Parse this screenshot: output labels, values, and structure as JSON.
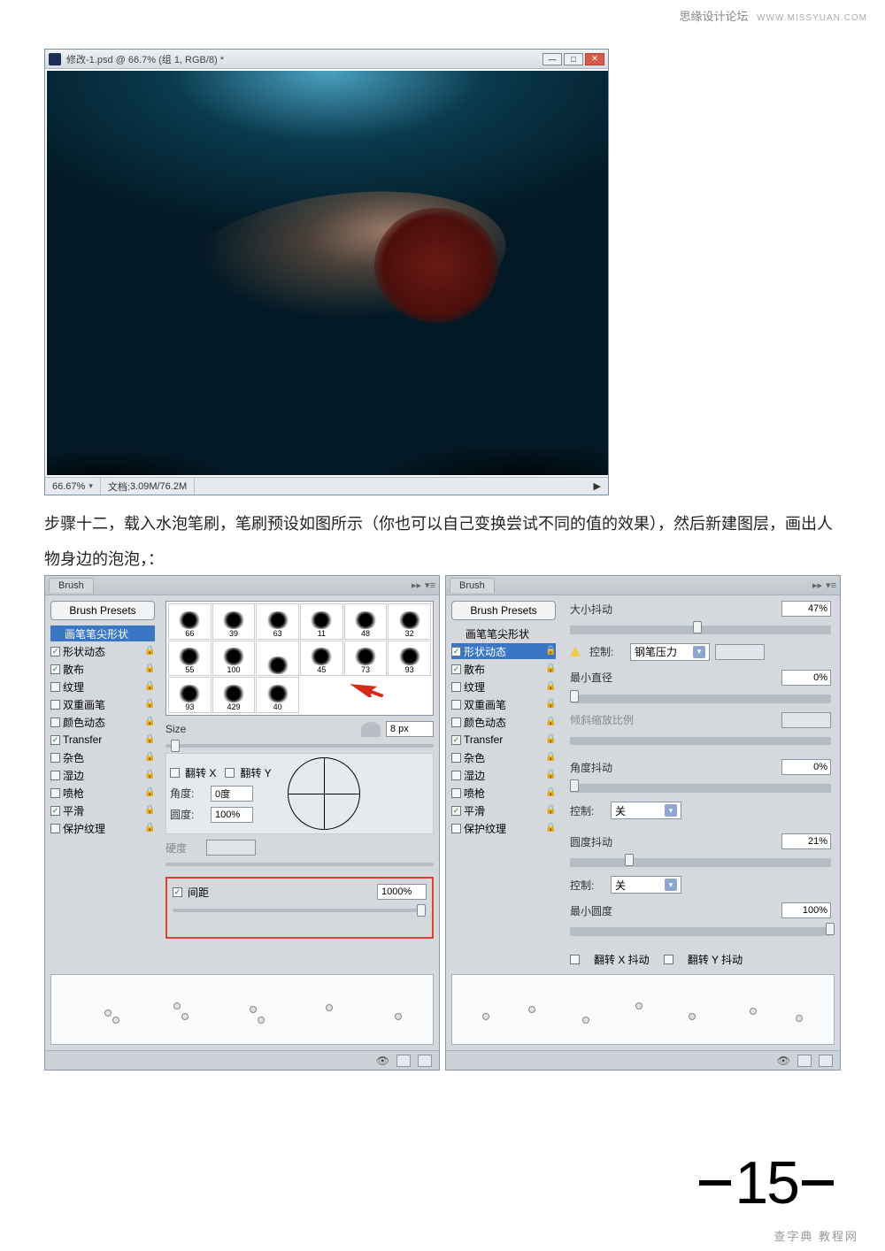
{
  "watermark": {
    "top_text": "思缘设计论坛",
    "top_url": "WWW.MISSYUAN.COM",
    "bottom_text": "查字典 教程网"
  },
  "page_number": "15",
  "ps_window": {
    "title": "修改-1.psd @ 66.7% (组 1, RGB/8) *",
    "zoom": "66.67%",
    "doc_label": "文档:",
    "doc_stat": "3.09M/76.2M"
  },
  "body_text": "步骤十二，载入水泡笔刷，笔刷预设如图所示（你也可以自己变换尝试不同的值的效果），然后新建图层，画出人物身边的泡泡，：",
  "brush_common": {
    "tab": "Brush",
    "presets_btn": "Brush Presets",
    "sidebar_items": [
      {
        "label": "画笔笔尖形状",
        "checked": null,
        "lock": false,
        "selected": true
      },
      {
        "label": "形状动态",
        "checked": true,
        "lock": true,
        "selected": false
      },
      {
        "label": "散布",
        "checked": true,
        "lock": true,
        "selected": false
      },
      {
        "label": "纹理",
        "checked": false,
        "lock": true,
        "selected": false
      },
      {
        "label": "双重画笔",
        "checked": false,
        "lock": true,
        "selected": false
      },
      {
        "label": "颜色动态",
        "checked": false,
        "lock": true,
        "selected": false
      },
      {
        "label": "Transfer",
        "checked": true,
        "lock": true,
        "selected": false
      },
      {
        "label": "杂色",
        "checked": false,
        "lock": true,
        "selected": false
      },
      {
        "label": "湿边",
        "checked": false,
        "lock": true,
        "selected": false
      },
      {
        "label": "喷枪",
        "checked": false,
        "lock": true,
        "selected": false
      },
      {
        "label": "平滑",
        "checked": true,
        "lock": true,
        "selected": false
      },
      {
        "label": "保护纹理",
        "checked": false,
        "lock": true,
        "selected": false
      }
    ]
  },
  "brush_left": {
    "sidebar_selected_override": "画笔笔尖形状",
    "thumbs": [
      "66",
      "39",
      "63",
      "11",
      "48",
      "32",
      "55",
      "100",
      "",
      "45",
      "73",
      "93",
      "93",
      "429",
      "40"
    ],
    "size_label": "Size",
    "size_value": "8 px",
    "flip_x": "翻转 X",
    "flip_y": "翻转 Y",
    "angle_label": "角度:",
    "angle_value": "0度",
    "roundness_label": "圆度:",
    "roundness_value": "100%",
    "hardness_label": "硬度",
    "spacing_label": "间距",
    "spacing_value": "1000%"
  },
  "brush_right": {
    "sidebar_selected_override": "形状动态",
    "size_jitter_label": "大小抖动",
    "size_jitter_value": "47%",
    "control_label": "控制:",
    "control_pen": "钢笔压力",
    "control_off": "关",
    "min_diameter_label": "最小直径",
    "min_diameter_value": "0%",
    "tilt_scale_label": "倾斜缩放比例",
    "angle_jitter_label": "角度抖动",
    "angle_jitter_value": "0%",
    "roundness_jitter_label": "圆度抖动",
    "roundness_jitter_value": "21%",
    "min_roundness_label": "最小圆度",
    "min_roundness_value": "100%",
    "flip_x_jitter": "翻转 X 抖动",
    "flip_y_jitter": "翻转 Y 抖动"
  }
}
